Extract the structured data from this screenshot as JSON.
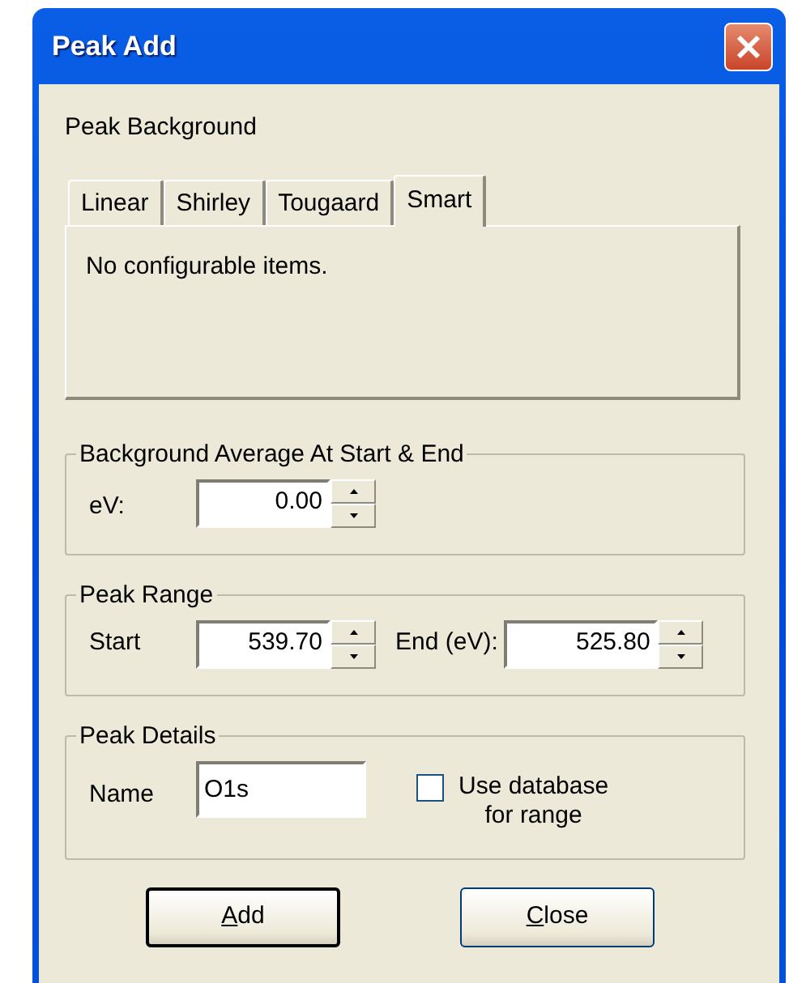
{
  "window": {
    "title": "Peak Add"
  },
  "section_label": "Peak Background",
  "tabs": [
    {
      "label": "Linear",
      "selected": false
    },
    {
      "label": "Shirley",
      "selected": false
    },
    {
      "label": "Tougaard",
      "selected": false
    },
    {
      "label": "Smart",
      "selected": true
    }
  ],
  "tab_content": "No configurable items.",
  "background_average": {
    "legend": "Background Average At Start & End",
    "label": "eV:",
    "value": "0.00"
  },
  "peak_range": {
    "legend": "Peak Range",
    "start_label": "Start",
    "start_value": "539.70",
    "end_label": "End (eV):",
    "end_value": "525.80"
  },
  "peak_details": {
    "legend": "Peak Details",
    "name_label": "Name",
    "name_value": "O1s",
    "checkbox": {
      "label_line_1": "Use database",
      "label_line_2": "for range",
      "checked": false
    }
  },
  "buttons": [
    {
      "accel": "A",
      "rest": "dd",
      "default": true
    },
    {
      "accel": "C",
      "rest": "lose",
      "default": false
    }
  ]
}
